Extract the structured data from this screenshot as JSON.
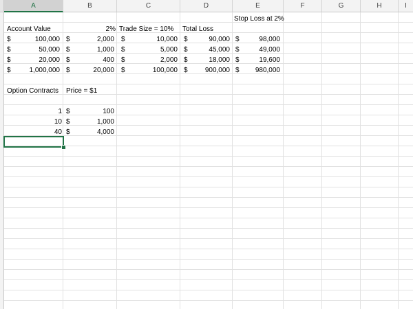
{
  "columns": [
    "A",
    "B",
    "C",
    "D",
    "E",
    "F",
    "G",
    "H",
    "I"
  ],
  "active_column": "A",
  "cells": {
    "e2": "Stop Loss at 2%",
    "a3": "Account Value",
    "b3": "2%",
    "c3": "Trade Size = 10%",
    "d3": "Total Loss",
    "currency_symbol": "$",
    "rows": [
      {
        "a": "100,000",
        "b": "2,000",
        "c": "10,000",
        "d": "90,000",
        "e": "98,000"
      },
      {
        "a": "50,000",
        "b": "1,000",
        "c": "5,000",
        "d": "45,000",
        "e": "49,000"
      },
      {
        "a": "20,000",
        "b": "400",
        "c": "2,000",
        "d": "18,000",
        "e": "19,600"
      },
      {
        "a": "1,000,000",
        "b": "20,000",
        "c": "100,000",
        "d": "900,000",
        "e": "980,000"
      }
    ],
    "a9": "Option Contracts",
    "b9": "Price = $1",
    "option_rows": [
      {
        "a": "1",
        "b": "100"
      },
      {
        "a": "10",
        "b": "1,000"
      },
      {
        "a": "40",
        "b": "4,000"
      }
    ]
  },
  "accent_color": "#217346"
}
